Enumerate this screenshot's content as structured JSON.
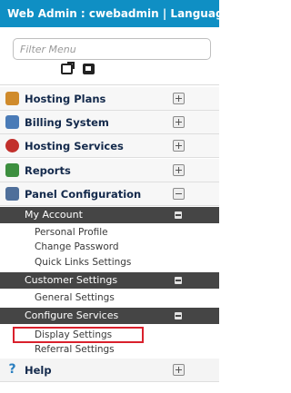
{
  "header": {
    "title": "Web Admin : cwebadmin | Language : Engl"
  },
  "filter": {
    "placeholder": "Filter Menu"
  },
  "icons": {
    "open_external": "open-external-icon",
    "dock": "dock-panel-icon"
  },
  "menu": {
    "sections": [
      {
        "label": "Hosting Plans",
        "icon": "hosting-plans-icon",
        "expanded": false
      },
      {
        "label": "Billing System",
        "icon": "billing-system-icon",
        "expanded": false
      },
      {
        "label": "Hosting Services",
        "icon": "hosting-services-icon",
        "expanded": false
      },
      {
        "label": "Reports",
        "icon": "reports-icon",
        "expanded": false
      },
      {
        "label": "Panel Configuration",
        "icon": "panel-configuration-icon",
        "expanded": true
      },
      {
        "label": "Help",
        "icon": "help-icon",
        "expanded": false
      }
    ],
    "panel_configuration": {
      "my_account": {
        "label": "My Account",
        "items": [
          "Personal Profile",
          "Change Password",
          "Quick Links Settings"
        ]
      },
      "customer_settings": {
        "label": "Customer Settings",
        "items": [
          "General Settings"
        ]
      },
      "configure_services": {
        "label": "Configure Services",
        "items": [
          "Display Settings",
          "Referral Settings"
        ],
        "highlighted_item": "Display Settings"
      }
    }
  },
  "colors": {
    "header_bg": "#0f8fc4",
    "subheader_bg": "#454545",
    "highlight_border": "#d9202c",
    "section_label": "#13294b"
  }
}
